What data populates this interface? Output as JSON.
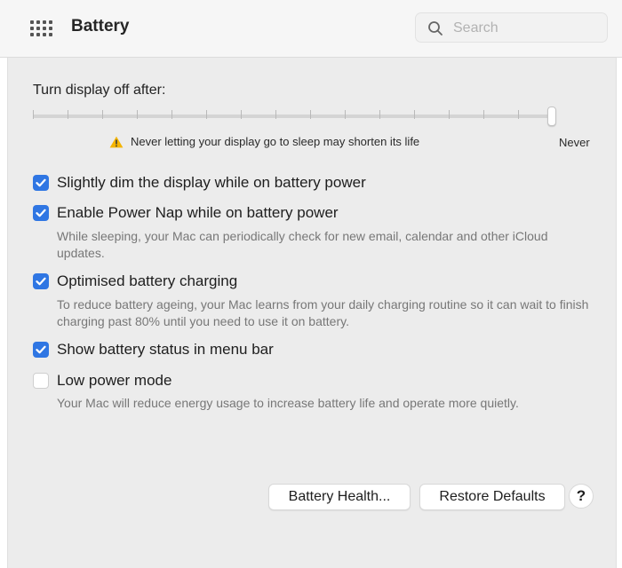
{
  "toolbar": {
    "title": "Battery",
    "grid_icon": "grid-icon",
    "search": {
      "placeholder": "Search",
      "value": "",
      "icon": "search-icon"
    }
  },
  "display_sleep": {
    "label": "Turn display off after:",
    "current_value": "Never",
    "end_label": "Never",
    "warning": {
      "icon": "warning-icon",
      "text": "Never letting your display go to sleep may shorten its life",
      "color": "#f4b400"
    }
  },
  "options": [
    {
      "label": "Slightly dim the display while on battery power",
      "checked": true
    },
    {
      "label": "Enable Power Nap while on battery power",
      "checked": true,
      "description": "While sleeping, your Mac can periodically check for new email, calendar and other iCloud updates."
    },
    {
      "label": "Optimised battery charging",
      "checked": true,
      "description": "To reduce battery ageing, your Mac learns from your daily charging routine so it can wait to finish charging past 80% until you need to use it on battery."
    },
    {
      "label": "Show battery status in menu bar",
      "checked": true
    },
    {
      "label": "Low power mode",
      "checked": false,
      "description": "Your Mac will reduce energy usage to increase battery life and operate more quietly."
    }
  ],
  "buttons": {
    "battery_health": "Battery Health...",
    "restore_defaults": "Restore Defaults",
    "help": "?"
  },
  "colors": {
    "accent": "#2f76e3",
    "panel": "#ececec",
    "toolbar": "#f6f6f6"
  }
}
